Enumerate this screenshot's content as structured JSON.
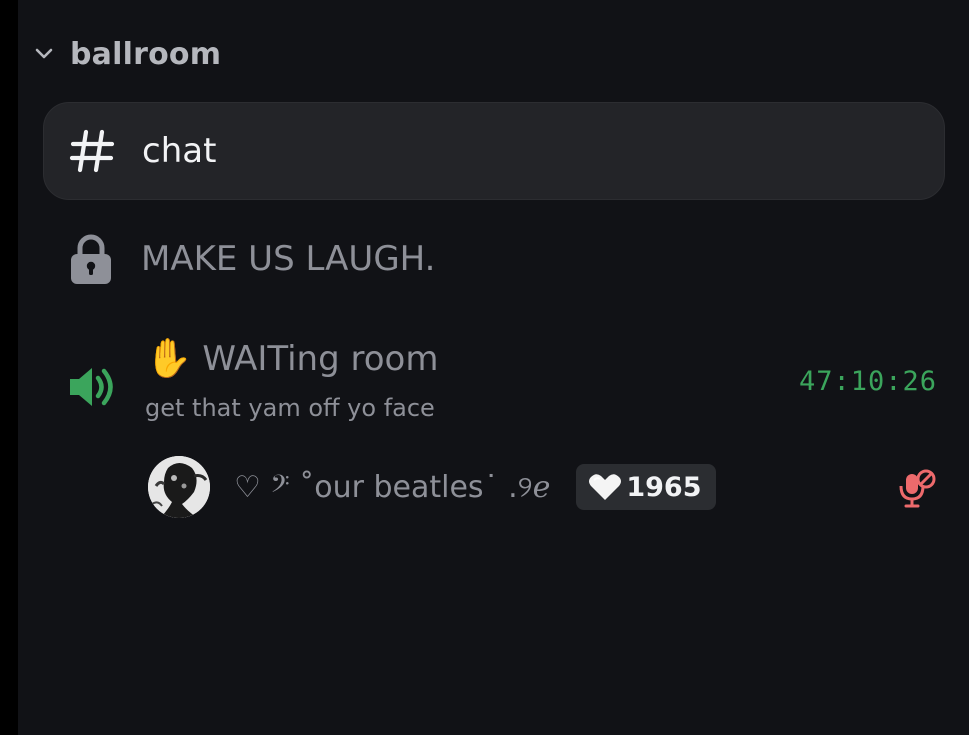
{
  "category": {
    "name": "ballroom",
    "icon": "chevron-down-icon"
  },
  "channels": {
    "chat": {
      "name": "chat",
      "icon": "hash-icon"
    },
    "locked": {
      "name": "MAKE US LAUGH.",
      "icon": "lock-icon"
    },
    "voice": {
      "emoji": "✋",
      "name": "WAITing room",
      "status": "get that yam off yo face",
      "timer": "47:10:26",
      "icon": "speaker-icon"
    }
  },
  "member": {
    "name": "♡ 𝄢 ˚our beatles˙ .୨ℯ",
    "badge_value": "1965",
    "badge_icon": "heart-icon",
    "mute_icon": "mic-muted-icon"
  },
  "colors": {
    "background": "#111216",
    "selected_channel": "#232428",
    "muted_text": "#8e9098",
    "voice_green": "#3ba55c",
    "mute_red": "#ed4245"
  }
}
